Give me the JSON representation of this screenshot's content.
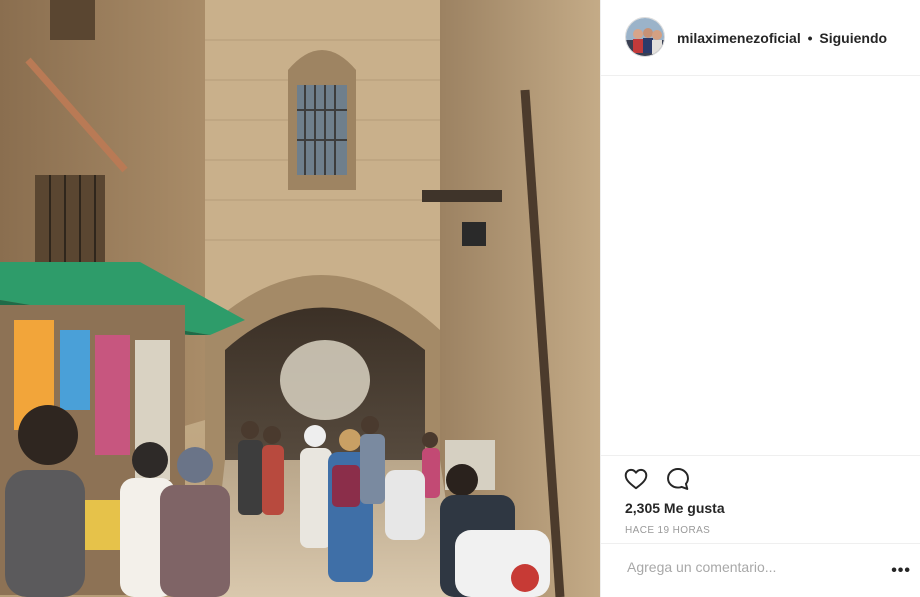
{
  "header": {
    "username": "milaximenezoficial",
    "separator": "•",
    "follow_status": "Siguiendo"
  },
  "actions": {
    "like_icon": "heart-icon",
    "comment_icon": "comment-bubble-icon"
  },
  "likes": "2,305 Me gusta",
  "timestamp": "HACE 19 HORAS",
  "comment": {
    "placeholder": "Agrega un comentario...",
    "more_label": "•••"
  },
  "colors": {
    "text": "#262626",
    "muted": "#999999",
    "divider": "#efefef",
    "awning": "#2e9c6a"
  }
}
